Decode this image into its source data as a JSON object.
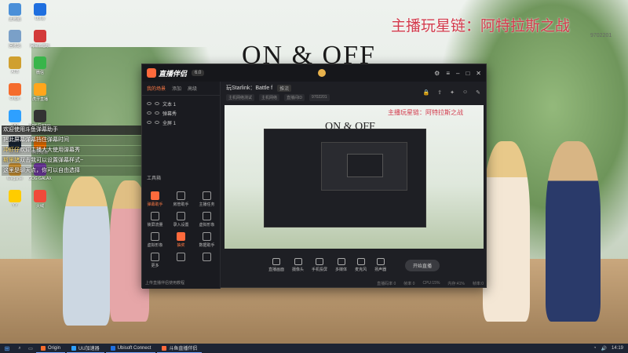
{
  "wallpaper": {
    "title": "ON & OFF",
    "overlay_title": "主播玩星链：阿特拉斯之战",
    "overlay_sub": "9702201"
  },
  "desktop_icons": [
    {
      "label": "此电脑",
      "color": "#4a8fd8"
    },
    {
      "label": "回收站",
      "color": "#7aa0c8"
    },
    {
      "label": "ATB",
      "color": "#d0a030"
    },
    {
      "label": "Origin",
      "color": "#f56c2d"
    },
    {
      "label": "QQ",
      "color": "#2ea0ff"
    },
    {
      "label": "Steam",
      "color": "#1b2838"
    },
    {
      "label": "Wegame",
      "color": "#e0a23a"
    },
    {
      "label": "YY",
      "color": "#ffcc00"
    },
    {
      "label": "Uplay",
      "color": "#1f6fdf"
    },
    {
      "label": "网易云音乐",
      "color": "#d33a3a"
    },
    {
      "label": "微信",
      "color": "#39b54a"
    },
    {
      "label": "虎牙直播",
      "color": "#ffa61c"
    },
    {
      "label": "Epic Games",
      "color": "#333333"
    },
    {
      "label": "腾讯视频",
      "color": "#ff7a00"
    },
    {
      "label": "GOG GALAXY",
      "color": "#7b3fb0"
    },
    {
      "label": "火绒",
      "color": "#f04a3a"
    }
  ],
  "chat": {
    "notice": "欢迎使用斗鱼弹幕助手",
    "rows": [
      {
        "name": "",
        "text": "把此屏幕弹幕挡住弹幕时间"
      },
      {
        "name": "冲虾仔",
        "text": "欢迎主播大大使用弹幕秀"
      },
      {
        "name": "斯里猪",
        "text": "双击我可以设置弹幕样式~"
      },
      {
        "name": "",
        "text": "这里是聊天点，你可以自由选择"
      }
    ]
  },
  "app": {
    "name": "直播伴侣",
    "version": "6.0",
    "left_tabs": [
      "我的场景",
      "添加",
      "高级"
    ],
    "scenes": [
      "文本 1",
      "弹幕秀",
      "全屏 1"
    ],
    "toolbox_title": "工具箱",
    "tools": [
      {
        "label": "弹幕助手",
        "hot": true
      },
      {
        "label": "房管助手",
        "hot": false
      },
      {
        "label": "主播任务",
        "hot": false
      },
      {
        "label": "锁屏流量",
        "hot": false
      },
      {
        "label": "录入设置",
        "hot": false
      },
      {
        "label": "虚拟形象",
        "hot": false
      },
      {
        "label": "虚拟形象",
        "hot": false
      },
      {
        "label": "抽奖",
        "hot": true
      },
      {
        "label": "数据助手",
        "hot": false
      },
      {
        "label": "更多",
        "hot": false
      },
      {
        "label": "",
        "hot": false
      },
      {
        "label": "",
        "hot": false
      }
    ],
    "left_footer": "上传直播伴侣使用教程",
    "stream_title": "玩Starlink：Battle f",
    "stream_tag": "推流",
    "meta": [
      "主机网络测试",
      "主机网络",
      "直播间ID",
      "9702201"
    ],
    "preview_title": "ON & OFF",
    "preview_overlay": "主播玩星链：阿特拉斯之战",
    "bottom_buttons": [
      "直播画面",
      "摄像头",
      "手机投屏",
      "多媒体",
      "麦克风",
      "扬声器"
    ],
    "start_live": "开始直播",
    "status": [
      "直播码率 0",
      "帧率 0",
      "CPU:15%",
      "内存:41%",
      "帧率:0"
    ]
  },
  "taskbar": {
    "items": [
      {
        "label": "Origin",
        "color": "#f56c2d"
      },
      {
        "label": "UU加速器",
        "color": "#2ea0ff"
      },
      {
        "label": "Ubisoft Connect",
        "color": "#1f6fdf"
      },
      {
        "label": "斗鱼直播伴侣",
        "color": "#ff6a3c"
      }
    ],
    "time": "14:19"
  }
}
